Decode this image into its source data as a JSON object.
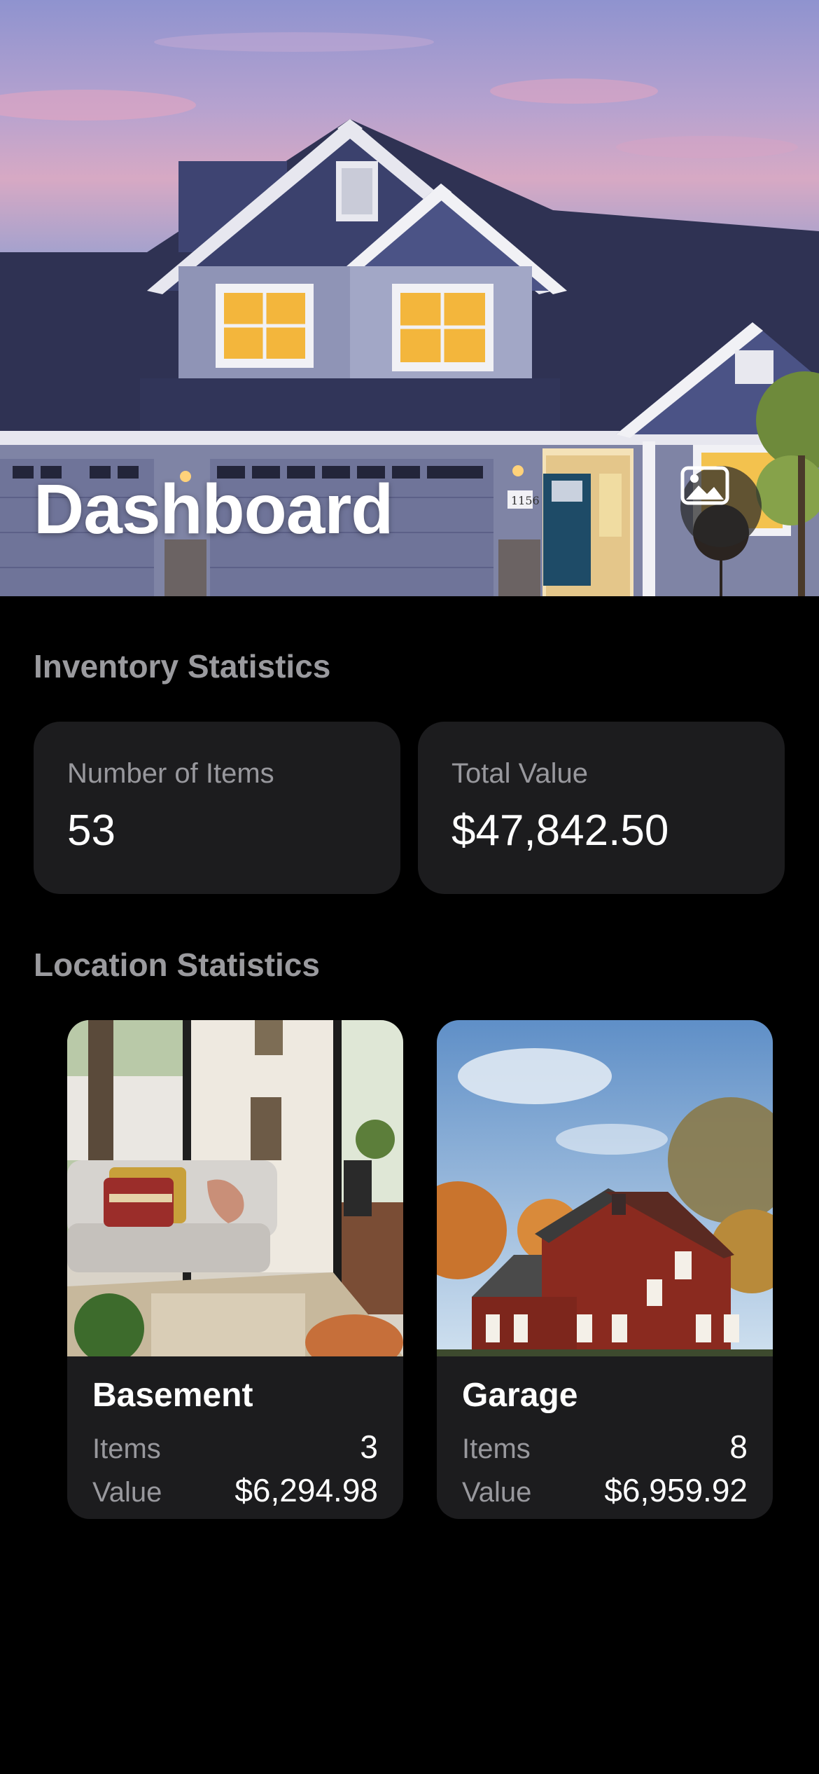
{
  "header": {
    "title": "Dashboard",
    "photo_icon": "photo-icon",
    "house_number": "1156"
  },
  "inventory": {
    "section_title": "Inventory Statistics",
    "items_label": "Number of Items",
    "items_value": "53",
    "value_label": "Total Value",
    "value_value": "$47,842.50"
  },
  "locations": {
    "section_title": "Location Statistics",
    "cards": [
      {
        "name": "Basement",
        "items_label": "Items",
        "items": "3",
        "value_label": "Value",
        "value": "$6,294.98"
      },
      {
        "name": "Garage",
        "items_label": "Items",
        "items": "8",
        "value_label": "Value",
        "value": "$6,959.92"
      }
    ]
  },
  "colors": {
    "background": "#000000",
    "card": "#1c1c1e",
    "secondary_text": "#98989d"
  }
}
